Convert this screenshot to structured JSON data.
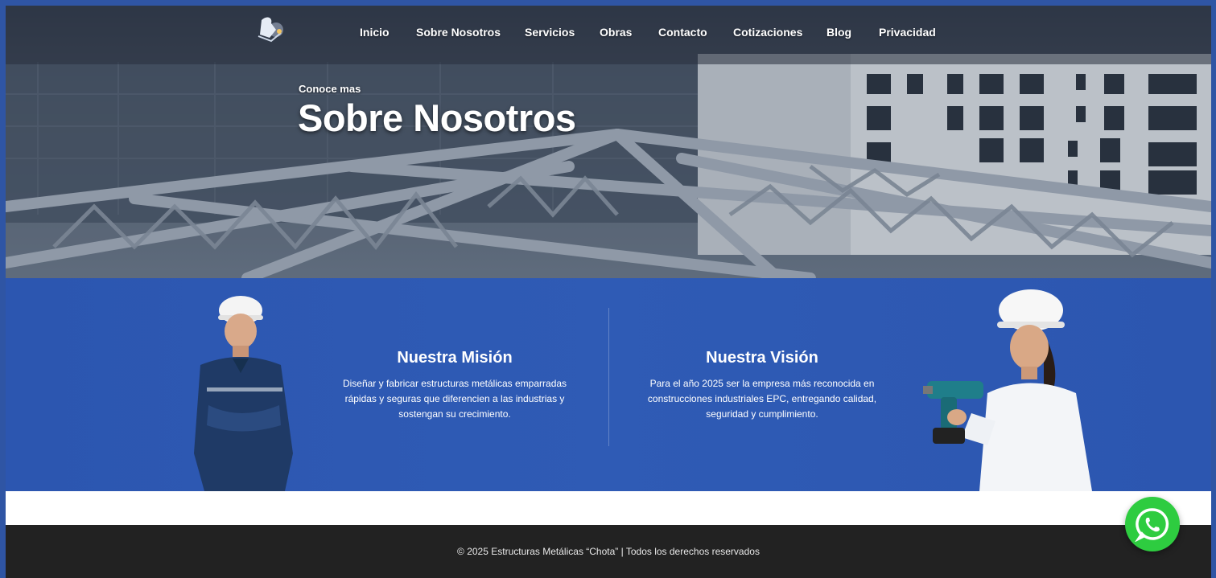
{
  "nav": {
    "logo_name": "welder-logo",
    "items": [
      {
        "label": "Inicio"
      },
      {
        "label": "Sobre Nosotros"
      },
      {
        "label": "Servicios"
      },
      {
        "label": "Obras"
      },
      {
        "label": "Contacto"
      },
      {
        "label": "Cotizaciones"
      },
      {
        "label": "Blog"
      },
      {
        "label": "Privacidad"
      }
    ]
  },
  "hero": {
    "kicker": "Conoce mas",
    "title": "Sobre Nosotros"
  },
  "mission": {
    "title": "Nuestra Misión",
    "lines": [
      "Diseñar y fabricar estructuras metálicas emparradas",
      "rápidas y seguras que diferencien a las industrias y",
      "sostengan su crecimiento."
    ]
  },
  "vision": {
    "title": "Nuestra Visión",
    "lines": [
      "Para el año 2025 ser la empresa más reconocida en",
      "construcciones industriales EPC, entregando calidad,",
      "seguridad y cumplimiento."
    ]
  },
  "footer": {
    "text": "© 2025 Estructuras Metálicas “Chota” | Todos los derechos reservados"
  },
  "floating": {
    "icon": "whatsapp-icon"
  },
  "colors": {
    "page_border": "#2f55a4",
    "section_blue": "#2f5bb5",
    "footer_bg": "#222222",
    "whatsapp_green": "#2ecc40"
  }
}
